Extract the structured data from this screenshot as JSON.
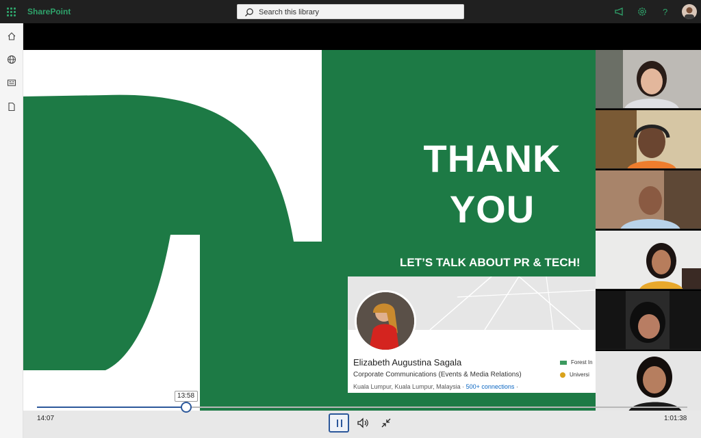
{
  "app": {
    "name": "SharePoint"
  },
  "search": {
    "placeholder": "Search this library"
  },
  "header_icons": [
    "megaphone-icon",
    "gear-icon",
    "help-icon",
    "user-avatar"
  ],
  "left_nav": [
    "home-icon",
    "globe-icon",
    "news-icon",
    "page-icon"
  ],
  "slide": {
    "heading_line1": "THANK",
    "heading_line2": "YOU",
    "subheading": "LET’S TALK ABOUT PR & TECH!",
    "profile": {
      "name": "Elizabeth Augustina Sagala",
      "title": "Corporate Communications (Events & Media Relations)",
      "location": "Kuala Lumpur, Kuala Lumpur, Malaysia",
      "connections": "500+ connections",
      "separator": "·",
      "org1": "Forest In",
      "org2": "Universi"
    }
  },
  "player": {
    "current_time": "14:07",
    "hover_time": "13:58",
    "duration": "1:01:38",
    "progress": 0.229
  },
  "colors": {
    "brand_green": "#1d7a45",
    "sharepoint_accent": "#2fa36b",
    "player_accent": "#2b579a"
  }
}
